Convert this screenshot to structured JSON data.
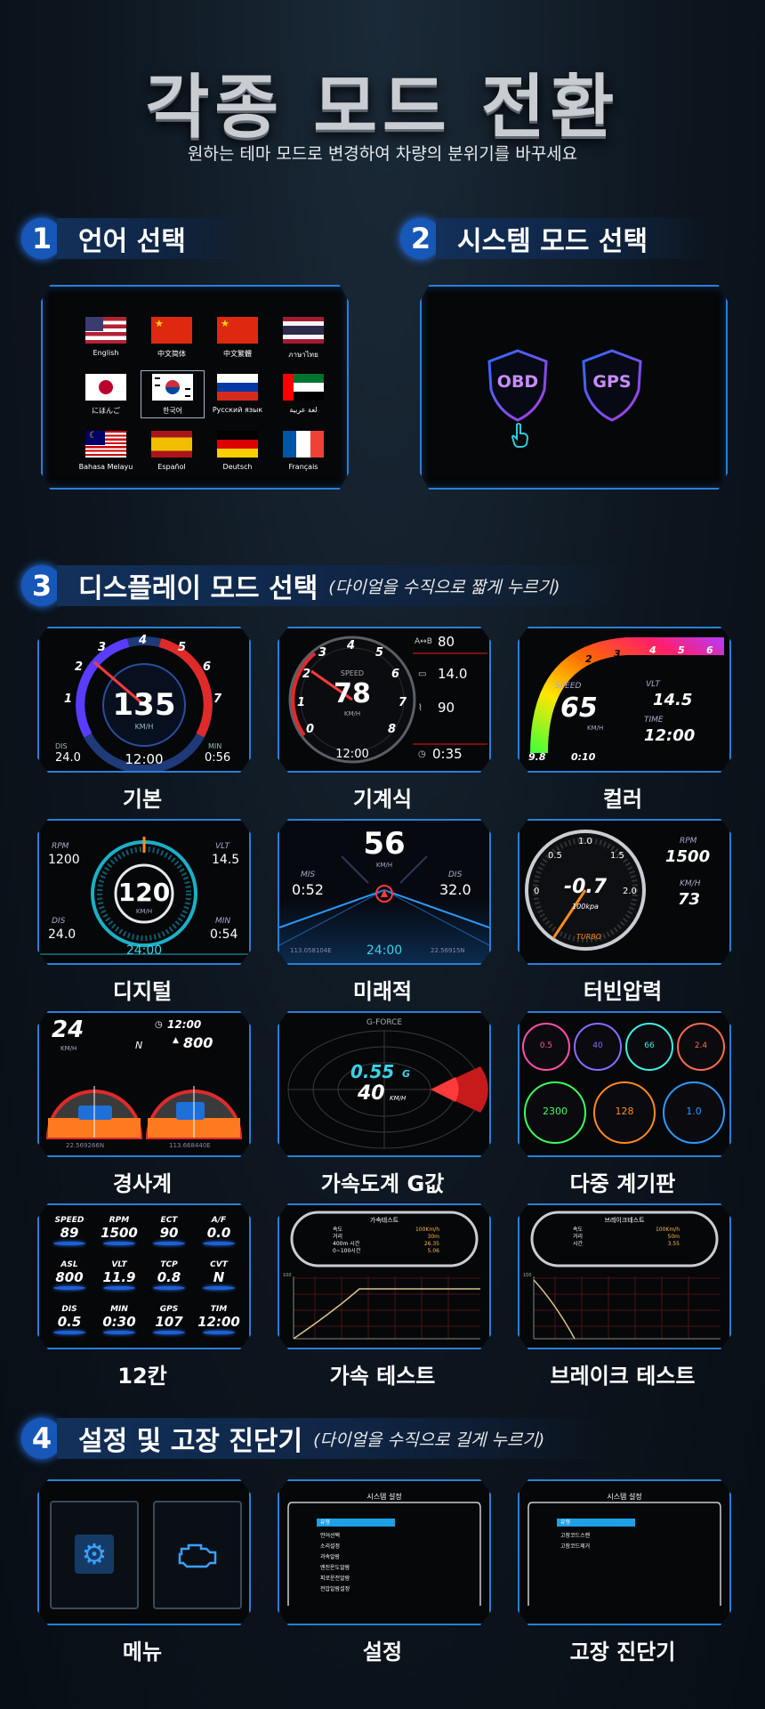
{
  "hero": {
    "title": "각종 모드 전환",
    "subtitle": "원하는 테마 모드로 변경하여 차량의 분위기를 바꾸세요"
  },
  "sections": {
    "lang": {
      "num": "1",
      "label": "언어 선택"
    },
    "system": {
      "num": "2",
      "label": "시스템 모드 선택"
    },
    "display": {
      "num": "3",
      "label": "디스플레이 모드 선택",
      "hint": "(다이얼을 수직으로 짧게 누르기)"
    },
    "settings": {
      "num": "4",
      "label": "설정 및 고장 진단기",
      "hint": "(다이얼을 수직으로 길게 누르기)"
    }
  },
  "languages": [
    "English",
    "中文简体",
    "中文繁體",
    "ภาษาไทย",
    "にほんご",
    "한국어",
    "Русский язык",
    "لغة عربية",
    "Bahasa Melayu",
    "Español",
    "Deutsch",
    "Français"
  ],
  "system_modes": [
    "OBD",
    "GPS"
  ],
  "display_modes": {
    "basic": {
      "caption": "기본",
      "speed": "135",
      "unit": "KM/H",
      "time": "12:00",
      "dis_label": "DIS",
      "dis": "24.0",
      "min_label": "MIN",
      "min": "0:56",
      "ticks": [
        "0",
        "1",
        "2",
        "3",
        "4",
        "5",
        "6",
        "7",
        "8"
      ]
    },
    "mechanical": {
      "caption": "기계식",
      "label": "SPEED",
      "speed": "78",
      "unit": "KM/H",
      "time": "12:00",
      "r1": "80",
      "r2": "14.0",
      "r3": "90",
      "r4": "0:35",
      "ticks": [
        "0",
        "1",
        "2",
        "3",
        "4",
        "5",
        "6",
        "7",
        "8"
      ]
    },
    "color": {
      "caption": "컬러",
      "speed_label": "SPEED",
      "speed": "65",
      "unit": "KM/H",
      "vlt_label": "VLT",
      "vlt": "14.5",
      "time_label": "TIME",
      "time": "12:00",
      "b1": "9.8",
      "b2": "0:10",
      "ticks": [
        "2",
        "3",
        "4",
        "5",
        "6"
      ]
    },
    "digital": {
      "caption": "디지털",
      "rpm_label": "RPM",
      "rpm": "1200",
      "vlt_label": "VLT",
      "vlt": "14.5",
      "speed": "120",
      "unit": "KM/H",
      "dis_label": "DIS",
      "dis": "24.0",
      "min_label": "MIN",
      "min": "0:54",
      "time": "24:00"
    },
    "future": {
      "caption": "미래적",
      "speed": "56",
      "unit": "KM/H",
      "mis_label": "MIS",
      "mis": "0:52",
      "dis_label": "DIS",
      "dis": "32.0",
      "time": "24:00",
      "lng": "113.058104E",
      "lat": "22.56915N"
    },
    "turbo": {
      "caption": "터빈압력",
      "value": "-0.7",
      "unit": "100kpa",
      "label": "TURBO",
      "rpm_label": "RPM",
      "rpm": "1500",
      "kmh_label": "KM/H",
      "kmh": "73",
      "ticks": [
        "0",
        "0.5",
        "1.0",
        "1.5",
        "2.0"
      ]
    },
    "incline": {
      "caption": "경사계",
      "speed": "24",
      "unit": "KM/H",
      "time": "12:00",
      "alt": "800",
      "lat": "22.569266N",
      "lng": "113.668440E"
    },
    "gforce": {
      "caption": "가속도계 G값",
      "title": "G-FORCE",
      "g": "0.55",
      "g_unit": "G",
      "speed": "40",
      "unit": "KM/H"
    },
    "multi": {
      "caption": "다중 계기판",
      "values": [
        "0.5",
        "40",
        "66",
        "2.4",
        "2300",
        "128",
        "1.0"
      ]
    },
    "grid12": {
      "caption": "12칸",
      "cells": [
        {
          "label": "SPEED",
          "value": "89"
        },
        {
          "label": "RPM",
          "value": "1500"
        },
        {
          "label": "ECT",
          "value": "90"
        },
        {
          "label": "A/F",
          "value": "0.0"
        },
        {
          "label": "ASL",
          "value": "800"
        },
        {
          "label": "VLT",
          "value": "11.9"
        },
        {
          "label": "TCP",
          "value": "0.8"
        },
        {
          "label": "CVT",
          "value": "N"
        },
        {
          "label": "DIS",
          "value": "0.5"
        },
        {
          "label": "MIN",
          "value": "0:30"
        },
        {
          "label": "GPS",
          "value": "107"
        },
        {
          "label": "TIM",
          "value": "12:00"
        }
      ]
    },
    "accel_test": {
      "caption": "가속 테스트",
      "title": "가속테스트",
      "rows": [
        "속도",
        "거리",
        "400m 시간",
        "0~100시간"
      ],
      "vals": [
        "100Km/h",
        "30m",
        "26.35",
        "5.06"
      ],
      "ymax": "100"
    },
    "brake_test": {
      "caption": "브레이크 테스트",
      "title": "브레이크테스트",
      "rows": [
        "속도",
        "거리",
        "시간"
      ],
      "vals": [
        "100Km/h",
        "50m",
        "3.55"
      ],
      "ymax": "100"
    }
  },
  "settings_screens": {
    "menu": {
      "caption": "메뉴"
    },
    "setup": {
      "caption": "설정",
      "title": "시스템 설정",
      "items": [
        "언어선택",
        "소리설정",
        "과속알람",
        "엔진온도알람",
        "피로운전알람",
        "전압알람설정"
      ],
      "selected": "유형"
    },
    "diag": {
      "caption": "고장 진단기",
      "title": "시스템 설정",
      "items": [
        "고장코드스캔",
        "고장코드제거"
      ],
      "selected": "유형"
    }
  },
  "colors": {
    "accent": "#1657b8",
    "glow": "#2a7fd8",
    "red": "#e52a2a",
    "cyan": "#28d6e6"
  }
}
